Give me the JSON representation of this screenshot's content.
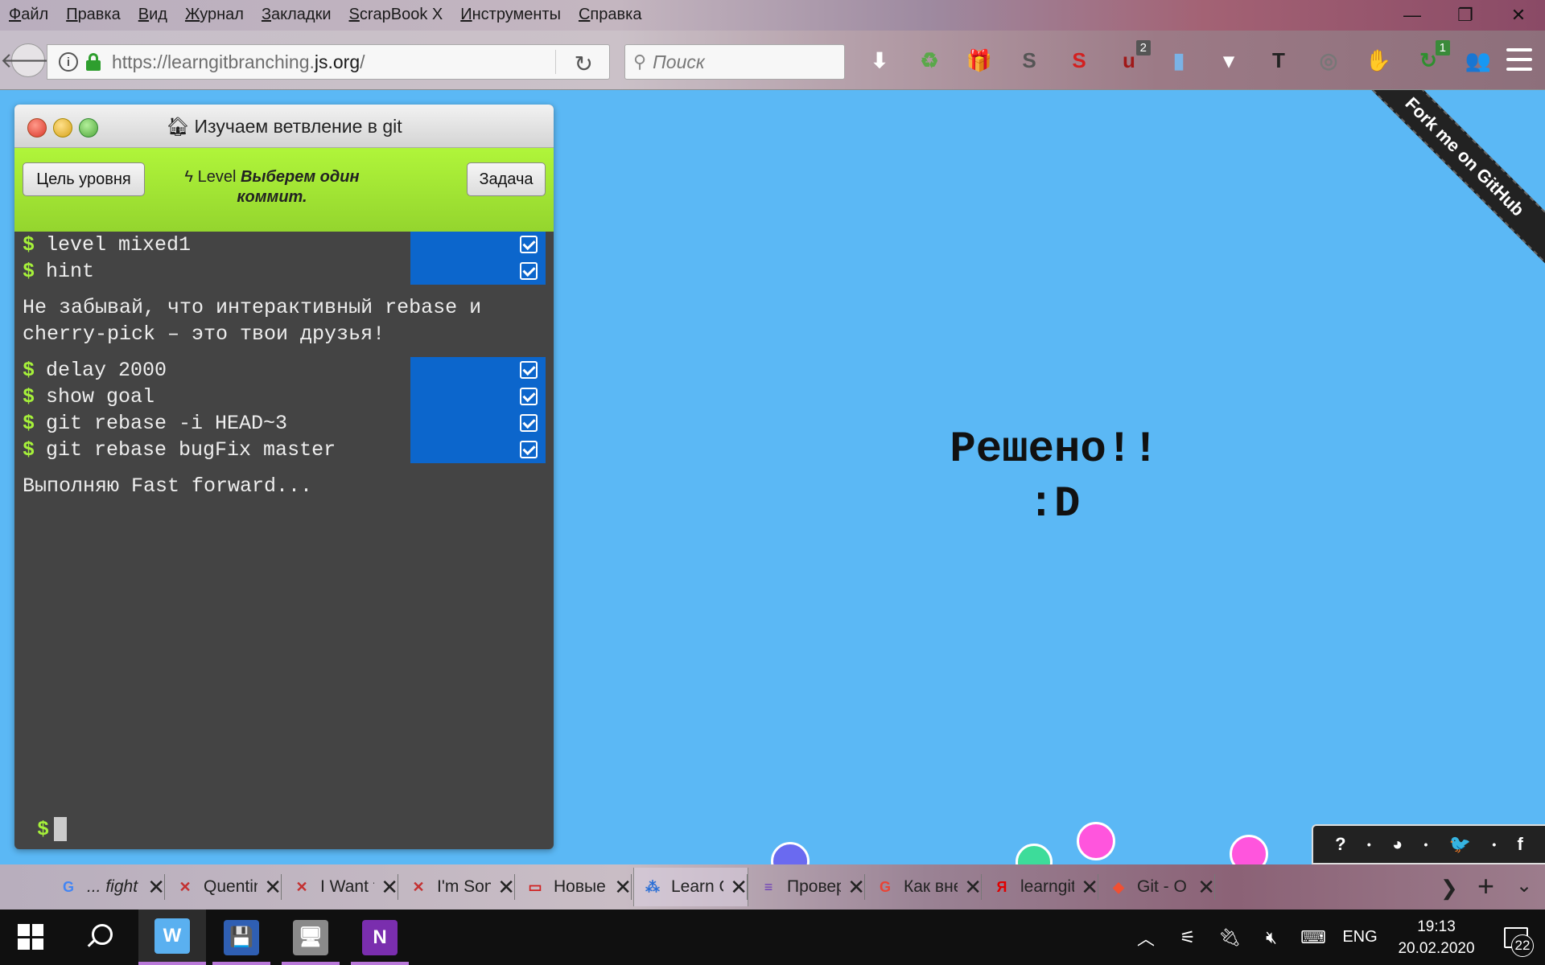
{
  "menu": {
    "items": [
      {
        "u": "Ф",
        "rest": "айл"
      },
      {
        "u": "П",
        "rest": "равка"
      },
      {
        "u": "В",
        "rest": "ид"
      },
      {
        "u": "Ж",
        "rest": "урнал"
      },
      {
        "u": "З",
        "rest": "акладки"
      },
      {
        "u": "S",
        "rest": "crapBook X"
      },
      {
        "u": "И",
        "rest": "нструменты"
      },
      {
        "u": "С",
        "rest": "правка"
      }
    ]
  },
  "window_controls": {
    "minimize": "—",
    "restore": "❐",
    "close": "✕"
  },
  "nav": {
    "url_prefix": "https://learngitbranching.",
    "url_domain": "js.org",
    "url_suffix": "/",
    "search_placeholder": "Поиск",
    "toolbar_icons": [
      {
        "name": "download-icon",
        "glyph": "⬇",
        "color": "#ffffff"
      },
      {
        "name": "recycle-icon",
        "glyph": "♻",
        "color": "#5aa84a"
      },
      {
        "name": "gift-icon",
        "glyph": "🎁",
        "color": "#333333"
      },
      {
        "name": "s-extension-icon",
        "glyph": "S",
        "color": "#555555"
      },
      {
        "name": "s-red-extension-icon",
        "glyph": "S",
        "color": "#d32020"
      },
      {
        "name": "ublock-icon",
        "glyph": "u",
        "color": "#a01818",
        "badge": "2"
      },
      {
        "name": "bookmark-icon",
        "glyph": "▮",
        "color": "#7ab3e6"
      },
      {
        "name": "dropdown-icon",
        "glyph": "▾",
        "color": "#ffffff"
      },
      {
        "name": "t-extension-icon",
        "glyph": "T",
        "color": "#222222"
      },
      {
        "name": "globe-icon",
        "glyph": "◎",
        "color": "#777777"
      },
      {
        "name": "hand-icon",
        "glyph": "✋",
        "color": "#3a9a3a"
      },
      {
        "name": "sync-icon",
        "glyph": "↻",
        "color": "#2f8f2f",
        "badge": "1"
      },
      {
        "name": "people-icon",
        "glyph": "👥",
        "color": "#9a8a94"
      }
    ]
  },
  "terminal": {
    "title": "Изучаем ветвление в git",
    "goal_button": "Цель уровня",
    "task_button": "Задача",
    "level_prefix": "Level",
    "level_name": "Выберем один коммит.",
    "commands_1": [
      "level mixed1",
      "hint"
    ],
    "hint_output": "Не забывай, что интерактивный rebase и cherry-pick – это твои друзья!",
    "commands_2": [
      "delay 2000",
      "show goal",
      "git rebase -i HEAD~3",
      "git rebase bugFix master"
    ],
    "fast_forward_output": "Выполняю Fast forward...",
    "prompt": "$"
  },
  "solved": {
    "line1": "Решено!!",
    "line2": ":D"
  },
  "ribbon": "Fork me on GitHub",
  "social": {
    "help": "?",
    "globe": "◕",
    "twitter": "🐦",
    "facebook": "f",
    "dot": "•"
  },
  "graph_nodes_colors": {
    "blue": "#6a6af0",
    "green": "#3ddc9a",
    "pink": "#ff55dd"
  },
  "tabs": [
    {
      "label": "... fight",
      "icon": "G",
      "icon_color": "#4285f4"
    },
    {
      "label": "Quentin",
      "icon": "✕",
      "icon_color": "#c43030"
    },
    {
      "label": "I Want t",
      "icon": "✕",
      "icon_color": "#c43030"
    },
    {
      "label": "I'm Son",
      "icon": "✕",
      "icon_color": "#c43030"
    },
    {
      "label": "Новые",
      "icon": "▭",
      "icon_color": "#d02020"
    },
    {
      "label": "Learn G",
      "icon": "⁂",
      "icon_color": "#2b6fd6"
    },
    {
      "label": "Провер",
      "icon": "≡",
      "icon_color": "#6a3ab8"
    },
    {
      "label": "Как вне",
      "icon": "G",
      "icon_color": "#ea4335"
    },
    {
      "label": "learngit",
      "icon": "Я",
      "icon_color": "#e00000"
    },
    {
      "label": "Git - O",
      "icon": "◆",
      "icon_color": "#f05033"
    }
  ],
  "tab_controls": {
    "scroll_right": "❯",
    "new_tab": "+",
    "list": "⌄",
    "close": "✕"
  },
  "taskbar": {
    "apps": [
      {
        "name": "waterfox-app",
        "glyph": "W",
        "color": "#5ab0f0",
        "active": true
      },
      {
        "name": "floppy-app",
        "glyph": "💾",
        "color": "#2f5fb3",
        "active": false
      },
      {
        "name": "computer-app",
        "glyph": "🖥",
        "color": "#8a8a8a",
        "active": false
      },
      {
        "name": "onenote-app",
        "glyph": "N",
        "color": "#7a2eae",
        "active": false
      }
    ],
    "language": "ENG",
    "time": "19:13",
    "date": "20.02.2020",
    "notification_count": "22"
  }
}
